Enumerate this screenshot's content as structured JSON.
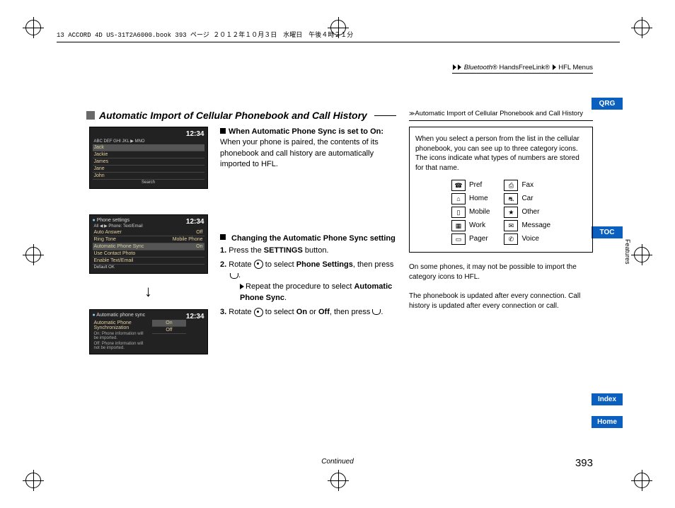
{
  "header_text": "13 ACCORD 4D US-31T2A6000.book  393 ページ  ２０１２年１０月３日　水曜日　午後４時２１分",
  "breadcrumb": {
    "b1": "Bluetooth",
    "reg": "®",
    "b2": " HandsFreeLink",
    "b3": "HFL Menus"
  },
  "section_title": "Automatic Import of Cellular Phonebook and Call History",
  "sub1_title": "When Automatic Phone Sync is set to On:",
  "sub1_body": "When your phone is paired, the contents of its phonebook and call history are automatically imported to HFL.",
  "sub2_title": "Changing the Automatic Phone Sync setting",
  "step1a": "1.",
  "step1b": "Press the ",
  "step1c": "SETTINGS",
  "step1d": " button.",
  "step2a": "2.",
  "step2b": "Rotate ",
  "step2c": " to select ",
  "step2d": "Phone Settings",
  "step2e": ", then press ",
  "step2f": ".",
  "step2sub_a": "Repeat the procedure to select ",
  "step2sub_b": "Automatic Phone Sync",
  "step2sub_c": ".",
  "step3a": "3.",
  "step3b": "Rotate ",
  "step3c": " to select ",
  "step3d": "On",
  "step3e": " or ",
  "step3f": "Off",
  "step3g": ", then press ",
  "step3h": ".",
  "side_header": "Automatic Import of Cellular Phonebook and Call History",
  "side_body": "When you select a person from the list in the cellular phonebook, you can see up to three category icons. The icons indicate what types of numbers are stored for that name.",
  "icons": {
    "pref": "Pref",
    "home": "Home",
    "mobile": "Mobile",
    "work": "Work",
    "pager": "Pager",
    "fax": "Fax",
    "car": "Car",
    "other": "Other",
    "message": "Message",
    "voice": "Voice"
  },
  "side_note1": "On some phones, it may not be possible to import the category icons to HFL.",
  "side_note2": "The phonebook is updated after every connection. Call history is updated after every connection or call.",
  "tabs": {
    "qrg": "QRG",
    "toc": "TOC",
    "features": "Features",
    "index": "Index",
    "home": "Home"
  },
  "continued": "Continued",
  "page_num": "393",
  "mock": {
    "time": "12:34",
    "s1": {
      "tabs": "ABC    DEF    GHI   JKL  ▶  MNO",
      "rows": [
        "Jack",
        "Jackie",
        "James",
        "Jane",
        "John"
      ],
      "search": "Search"
    },
    "s2": {
      "title": "Phone settings",
      "cols": "All  ◀ ▶  Phone:        Text/Email",
      "r1a": "Auto Answer",
      "r1b": "Off",
      "r2a": "Ring Tone",
      "r2b": "Mobile Phone",
      "r3a": "Automatic Phone Sync",
      "r3b": "On",
      "r4a": "Use Contact Photo",
      "r4b": "",
      "r5a": "Enable Text/Email",
      "r5b": "",
      "ft": "Default               OK"
    },
    "s3": {
      "title": "Automatic phone sync",
      "r1": "Automatic Phone Synchronization",
      "r2": "On: Phone information will be imported.",
      "r3": "Off: Phone information will not be imported.",
      "on": "On",
      "off": "Off"
    }
  }
}
